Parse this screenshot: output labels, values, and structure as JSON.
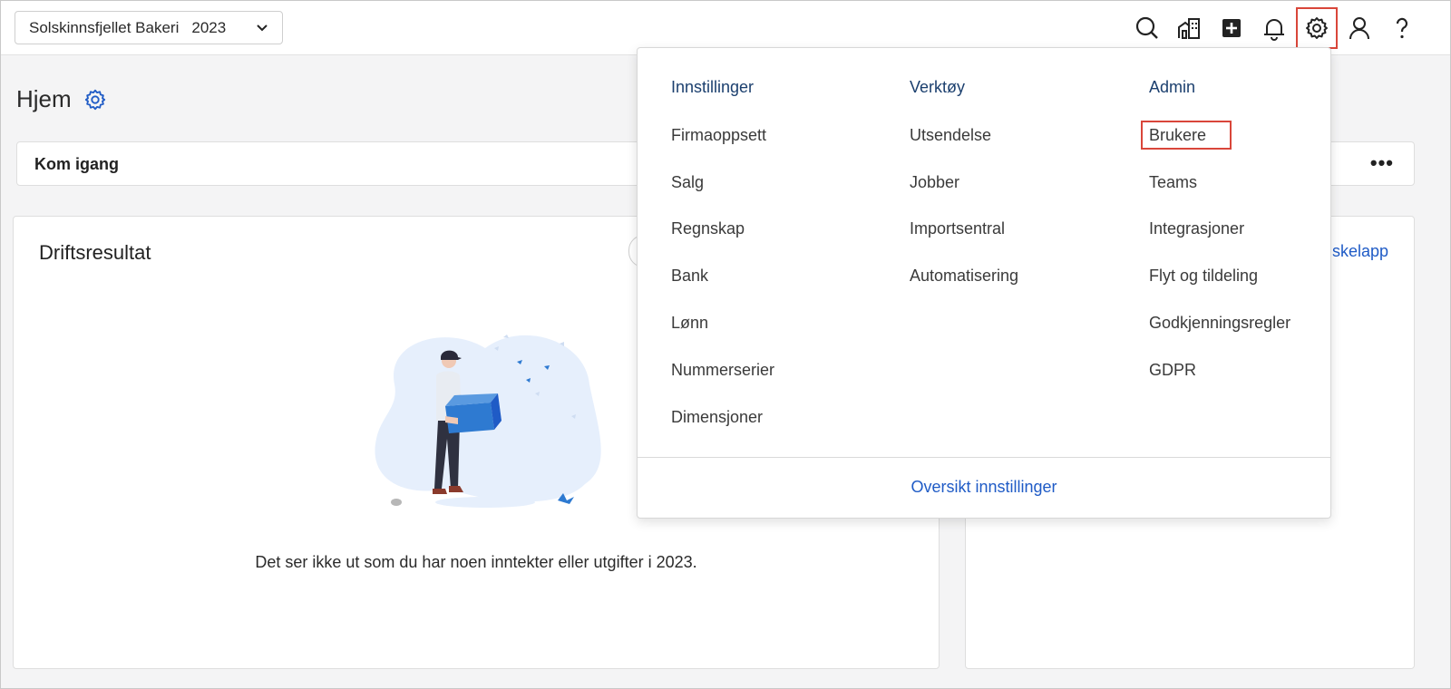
{
  "company_selector": {
    "company_name": "Solskinnsfjellet Bakeri",
    "year": "2023"
  },
  "top_icons": [
    {
      "name": "search-icon"
    },
    {
      "name": "building-icon"
    },
    {
      "name": "add-icon"
    },
    {
      "name": "bell-icon"
    },
    {
      "name": "gear-icon",
      "highlighted": true
    },
    {
      "name": "user-icon"
    },
    {
      "name": "help-icon"
    }
  ],
  "page": {
    "title": "Hjem"
  },
  "getting_started": {
    "label": "Kom igang",
    "more": "•••"
  },
  "operating_result_card": {
    "title": "Driftsresultat",
    "empty_message": "Det ser ikke ut som du har noen inntekter eller utgifter i 2023."
  },
  "right_card": {
    "link_text_partial": "skelapp"
  },
  "settings_menu": {
    "columns": [
      {
        "header": "Innstillinger",
        "items": [
          "Firmaoppsett",
          "Salg",
          "Regnskap",
          "Bank",
          "Lønn",
          "Nummerserier",
          "Dimensjoner"
        ]
      },
      {
        "header": "Verktøy",
        "items": [
          "Utsendelse",
          "Jobber",
          "Importsentral",
          "Automatisering"
        ]
      },
      {
        "header": "Admin",
        "items": [
          "Brukere",
          "Teams",
          "Integrasjoner",
          "Flyt og tildeling",
          "Godkjenningsregler",
          "GDPR"
        ],
        "highlighted_item": "Brukere"
      }
    ],
    "footer_link": "Oversikt innstillinger"
  },
  "colors": {
    "accent_link": "#1f5bc6",
    "header_text": "#1b3f6e",
    "highlight_box": "#d9463a",
    "illustration_blue": "#2e7ad1",
    "illustration_bg": "#e6effc"
  }
}
